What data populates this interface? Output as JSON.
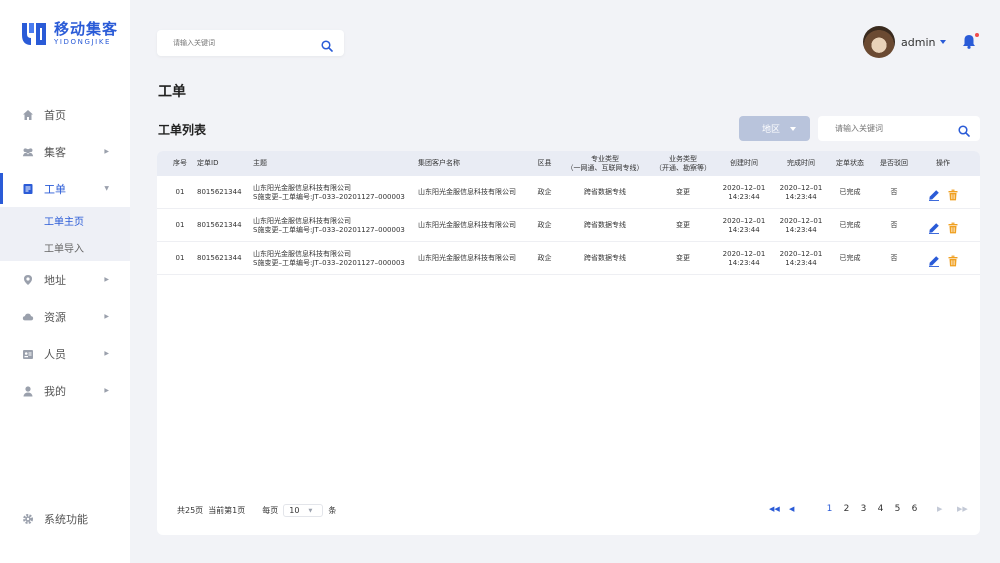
{
  "brand": {
    "name_cn": "移动集客",
    "name_en": "YIDONGJIKE",
    "color": "#2a5bd7"
  },
  "sidebar": {
    "items": [
      {
        "label": "首页",
        "icon": "home-icon",
        "has_children": false
      },
      {
        "label": "集客",
        "icon": "users-icon",
        "has_children": true
      },
      {
        "label": "工单",
        "icon": "document-icon",
        "has_children": true,
        "active": true
      },
      {
        "label": "地址",
        "icon": "location-pin-icon",
        "has_children": true
      },
      {
        "label": "资源",
        "icon": "cloud-icon",
        "has_children": true
      },
      {
        "label": "人员",
        "icon": "id-card-icon",
        "has_children": true
      },
      {
        "label": "我的",
        "icon": "user-icon",
        "has_children": true
      }
    ],
    "sub_items": [
      {
        "label": "工单主页",
        "active": true
      },
      {
        "label": "工单导入",
        "active": false
      }
    ],
    "system": {
      "label": "系统功能",
      "icon": "gear-icon"
    }
  },
  "header": {
    "search_placeholder": "请输入关键词",
    "username": "admin",
    "notification_icon": "bell-icon",
    "has_unread": true
  },
  "page": {
    "title": "工单",
    "list_title": "工单列表",
    "region_filter": "地区",
    "list_search_placeholder": "请输入关键词"
  },
  "table": {
    "columns": {
      "seq": "序号",
      "order_id": "定单ID",
      "subject": "主题",
      "customer": "集团客户名称",
      "district": "区县",
      "pro_type_1": "专业类型",
      "pro_type_2": "（一网通、互联网专线）",
      "biz_type_1": "业务类型",
      "biz_type_2": "（开通、勘察等）",
      "created": "创建时间",
      "completed": "完成时间",
      "status": "定单状态",
      "rejected": "是否驳回",
      "actions": "操作"
    },
    "rows": [
      {
        "seq": "01",
        "order_id": "8015621344",
        "subject_1": "山东阳光金服信息科技有限公司",
        "subject_2": "S施变更–工单编号:JT–033–20201127–000003",
        "customer": "山东阳光金服信息科技有限公司",
        "district": "政企",
        "pro_type": "跨省数据专线",
        "biz_type": "变更",
        "created_date": "2020–12–01",
        "created_time": "14:23:44",
        "completed_date": "2020–12–01",
        "completed_time": "14:23:44",
        "status": "已完成",
        "rejected": "否"
      },
      {
        "seq": "01",
        "order_id": "8015621344",
        "subject_1": "山东阳光金服信息科技有限公司",
        "subject_2": "S施变更–工单编号:JT–033–20201127–000003",
        "customer": "山东阳光金服信息科技有限公司",
        "district": "政企",
        "pro_type": "跨省数据专线",
        "biz_type": "变更",
        "created_date": "2020–12–01",
        "created_time": "14:23:44",
        "completed_date": "2020–12–01",
        "completed_time": "14:23:44",
        "status": "已完成",
        "rejected": "否"
      },
      {
        "seq": "01",
        "order_id": "8015621344",
        "subject_1": "山东阳光金服信息科技有限公司",
        "subject_2": "S施变更–工单编号:JT–033–20201127–000003",
        "customer": "山东阳光金服信息科技有限公司",
        "district": "政企",
        "pro_type": "跨省数据专线",
        "biz_type": "变更",
        "created_date": "2020–12–01",
        "created_time": "14:23:44",
        "completed_date": "2020–12–01",
        "completed_time": "14:23:44",
        "status": "已完成",
        "rejected": "否"
      }
    ],
    "row_actions": {
      "edit_icon": "edit-pencil-icon",
      "delete_icon": "trash-icon",
      "edit_color": "#2a5bd7",
      "delete_color": "#f0a020"
    }
  },
  "pagination": {
    "total": "共25页",
    "current": "当前第1页",
    "per_page_label": "每页",
    "per_page_value": "10",
    "per_page_unit": "条",
    "pages": [
      "1",
      "2",
      "3",
      "4",
      "5",
      "6"
    ],
    "current_page": "1"
  }
}
